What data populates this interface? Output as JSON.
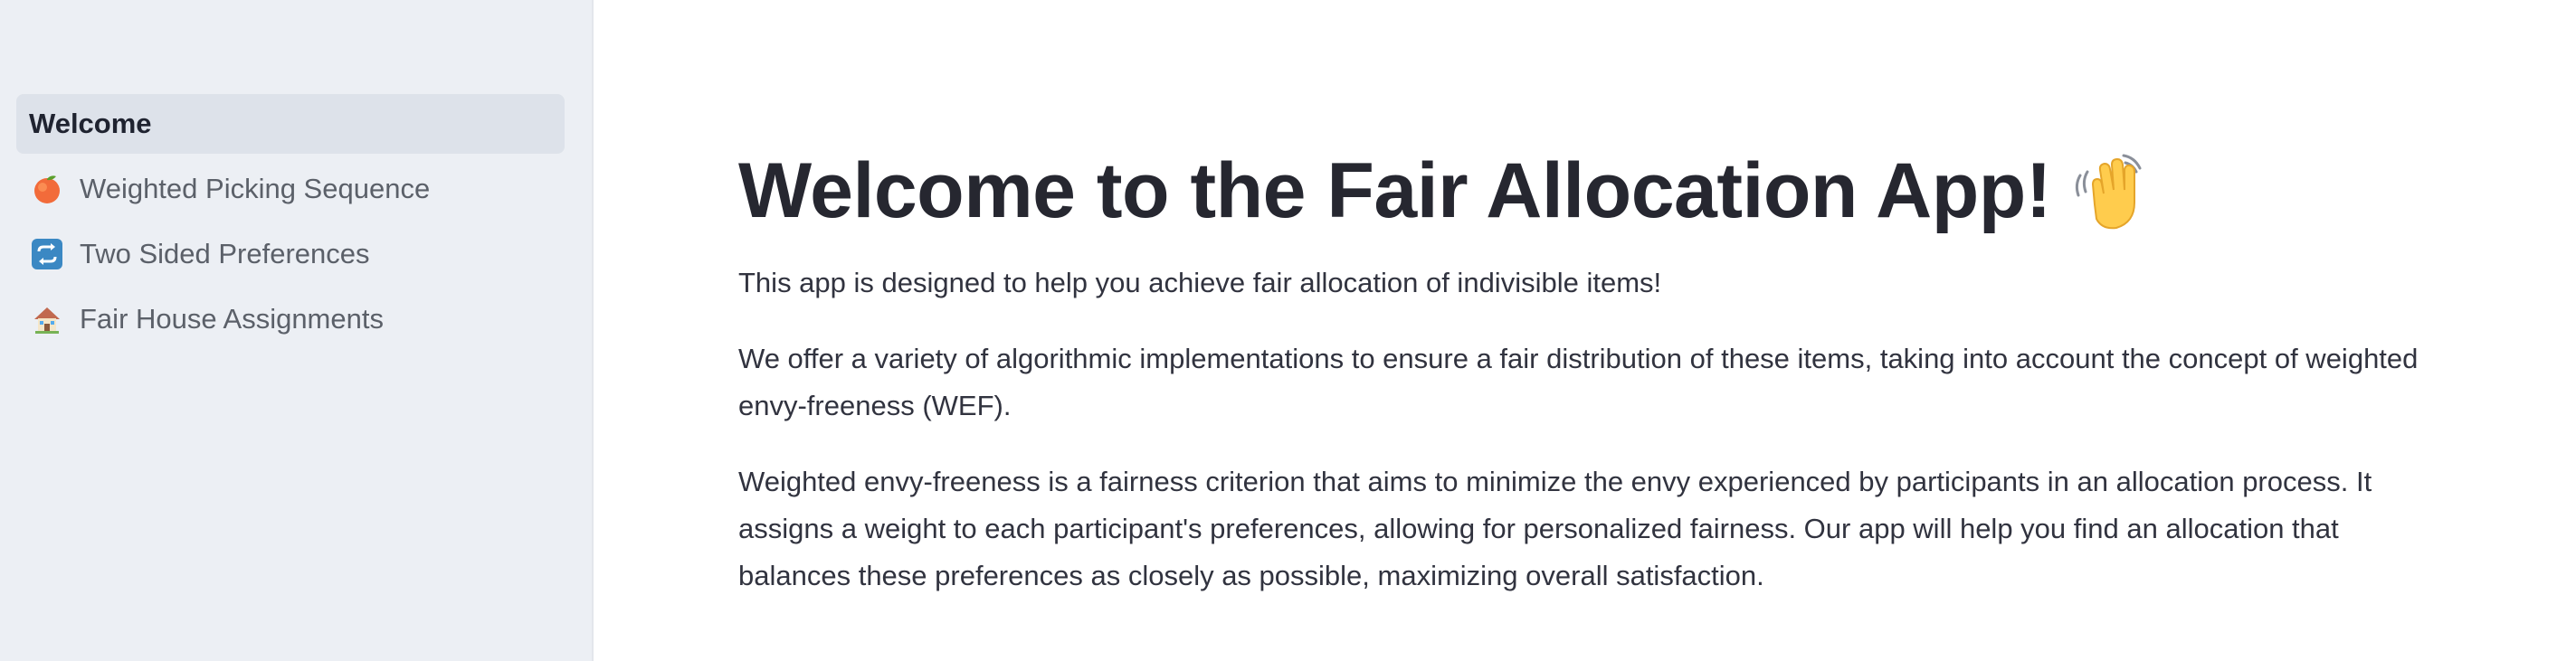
{
  "sidebar": {
    "items": [
      {
        "label": "Welcome",
        "icon": "",
        "active": true
      },
      {
        "label": "Weighted Picking Sequence",
        "icon": "peach-icon",
        "active": false
      },
      {
        "label": "Two Sided Preferences",
        "icon": "repeat-icon",
        "active": false
      },
      {
        "label": "Fair House Assignments",
        "icon": "house-icon",
        "active": false
      }
    ]
  },
  "main": {
    "title": "Welcome to the Fair Allocation App!",
    "title_icon": "waving-hand-icon",
    "paragraphs": [
      "This app is designed to help you achieve fair allocation of indivisible items!",
      "We offer a variety of algorithmic implementations to ensure a fair distribution of these items, taking into account the concept of weighted envy-freeness (WEF).",
      "Weighted envy-freeness is a fairness criterion that aims to minimize the envy experienced by participants in an allocation process. It assigns a weight to each participant's preferences, allowing for personalized fairness. Our app will help you find an allocation that balances these preferences as closely as possible, maximizing overall satisfaction."
    ]
  },
  "colors": {
    "sidebar_bg": "#eceff4",
    "active_item_bg": "#dde2ea",
    "text": "#31333f",
    "title": "#262730"
  }
}
